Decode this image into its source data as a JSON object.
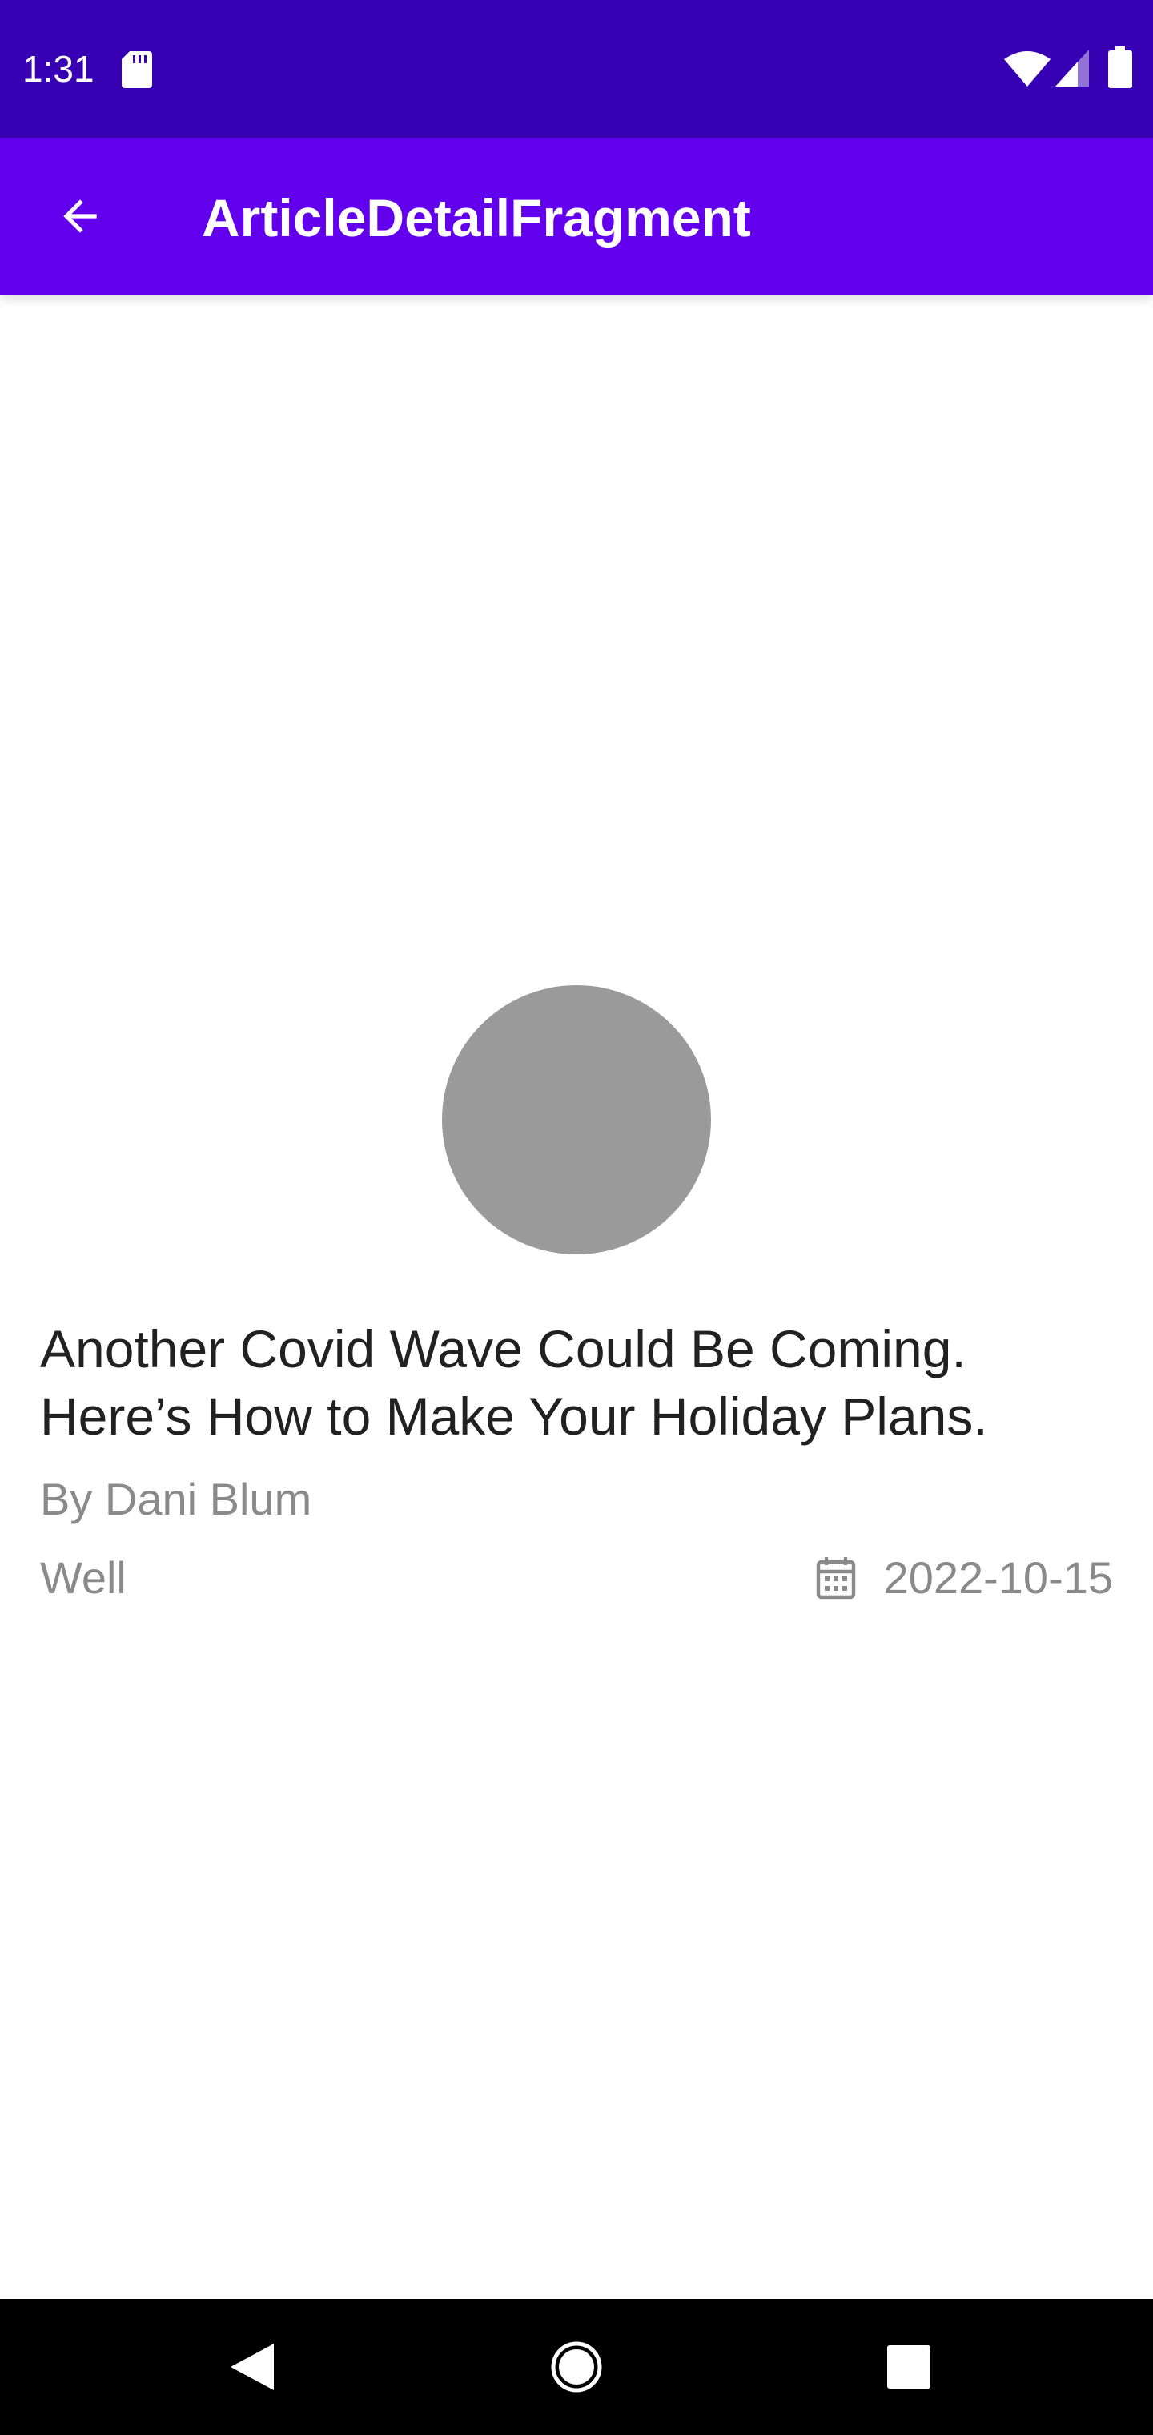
{
  "status_bar": {
    "time": "1:31",
    "icons": [
      "sd-card-icon",
      "wifi-icon",
      "signal-icon",
      "battery-icon"
    ],
    "background": "#3700b3"
  },
  "app_bar": {
    "title": "ArticleDetailFragment",
    "back_icon": "arrow-back-icon",
    "background": "#6200ee"
  },
  "article": {
    "title": "Another Covid Wave Could Be Coming. Here’s How to Make Your Holiday Plans.",
    "byline": "By Dani Blum",
    "section": "Well",
    "date": "2022-10-15",
    "date_icon": "calendar-icon",
    "image_placeholder_color": "#9a9a9a"
  },
  "nav_bar": {
    "buttons": [
      "nav-back-icon",
      "nav-home-icon",
      "nav-recents-icon"
    ]
  }
}
